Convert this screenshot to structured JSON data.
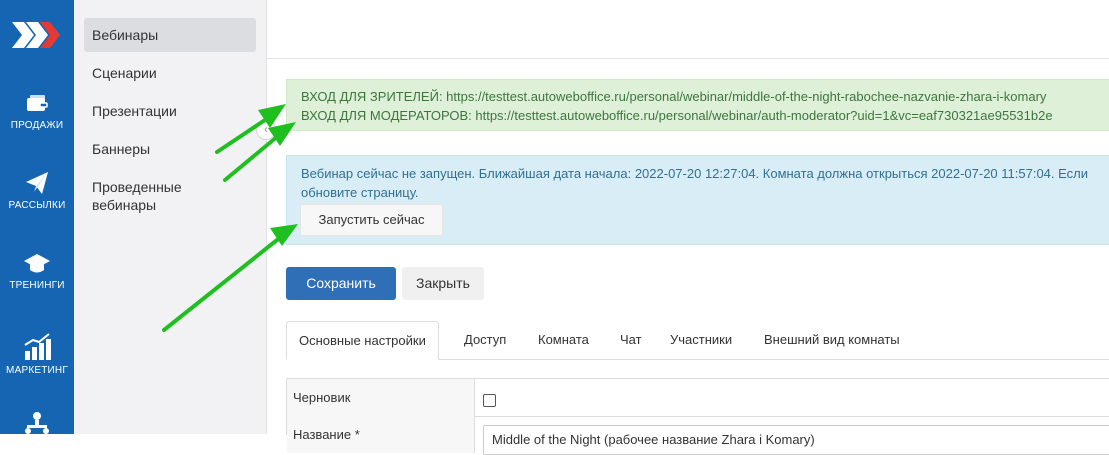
{
  "rail": {
    "items": [
      {
        "label": "ПРОДАЖИ",
        "icon": "wallet-icon"
      },
      {
        "label": "РАССЫЛКИ",
        "icon": "paper-plane-icon"
      },
      {
        "label": "ТРЕНИНГИ",
        "icon": "graduation-cap-icon"
      },
      {
        "label": "МАРКЕТИНГ",
        "icon": "growth-chart-icon"
      },
      {
        "label": "",
        "icon": "org-structure-icon"
      }
    ],
    "accent": "#1565b3"
  },
  "submenu": {
    "items": [
      {
        "label": "Вебинары",
        "active": true
      },
      {
        "label": "Сценарии"
      },
      {
        "label": "Презентации"
      },
      {
        "label": "Баннеры"
      },
      {
        "label": "Проведенные вебинары"
      }
    ]
  },
  "alerts": {
    "viewers": "ВХОД ДЛЯ ЗРИТЕЛЕЙ: https://testtest.autoweboffice.ru/personal/webinar/middle-of-the-night-rabochee-nazvanie-zhara-i-komary",
    "moderators": "ВХОД ДЛЯ МОДЕРАТОРОВ: https://testtest.autoweboffice.ru/personal/webinar/auth-moderator?uid=1&vc=eaf730321ae95531b2e",
    "not_started": "Вебинар сейчас не запущен. Ближайшая дата начала: 2022-07-20 12:27:04. Комната должна открыться 2022-07-20 11:57:04. Если обновите страницу.",
    "run_now": "Запустить сейчас"
  },
  "actions": {
    "save": "Сохранить",
    "close": "Закрыть",
    "save_color": "#2f6fb8"
  },
  "tabs": [
    {
      "label": "Основные настройки",
      "active": true
    },
    {
      "label": "Доступ"
    },
    {
      "label": "Комната"
    },
    {
      "label": "Чат"
    },
    {
      "label": "Участники"
    },
    {
      "label": "Внешний вид комнаты"
    }
  ],
  "form": {
    "draft_label": "Черновик",
    "draft_checked": false,
    "name_label": "Название *",
    "name_value": "Middle of the Night (рабочее название Zhara i Komary)"
  },
  "annotation_color": "#1fbf1f"
}
